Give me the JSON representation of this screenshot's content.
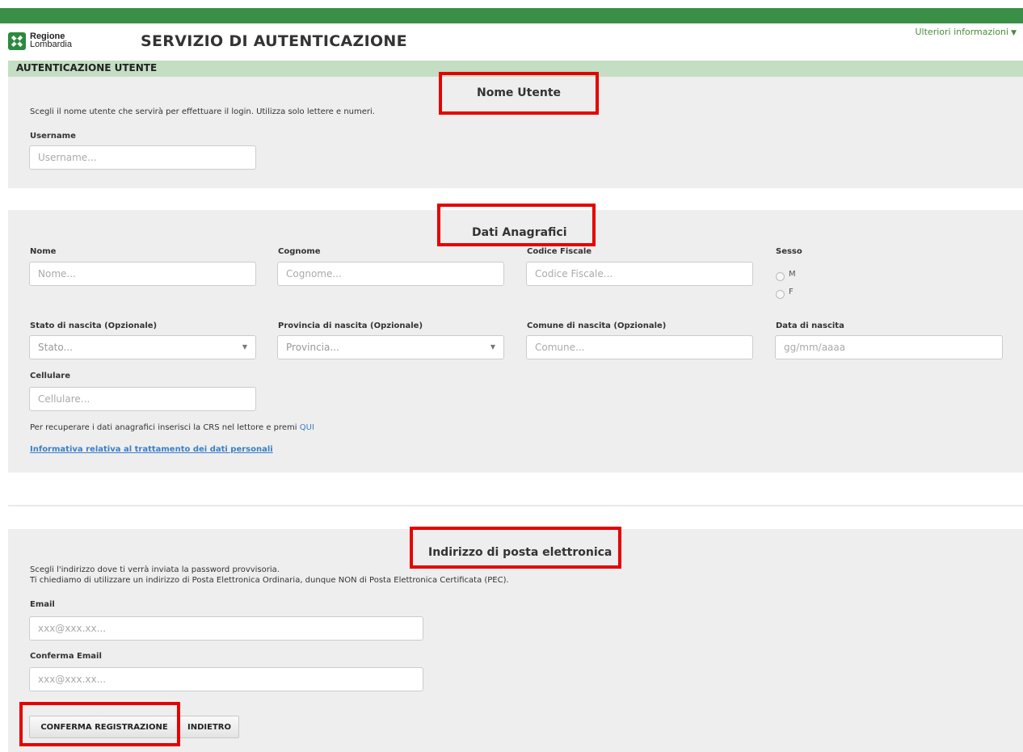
{
  "header": {
    "logo_line1": "Regione",
    "logo_line2": "Lombardia",
    "title": "SERVIZIO DI AUTENTICAZIONE",
    "more_info": "Ulteriori informazioni",
    "section": "AUTENTICAZIONE UTENTE"
  },
  "username_section": {
    "title": "Nome Utente",
    "help": "Scegli il nome utente che servirà per effettuare il login. Utilizza solo lettere e numeri.",
    "label": "Username",
    "placeholder": "Username..."
  },
  "personal_section": {
    "title": "Dati Anagrafici",
    "nome_label": "Nome",
    "nome_placeholder": "Nome...",
    "cognome_label": "Cognome",
    "cognome_placeholder": "Cognome...",
    "cf_label": "Codice Fiscale",
    "cf_placeholder": "Codice Fiscale...",
    "sesso_label": "Sesso",
    "sesso_m": "M",
    "sesso_f": "F",
    "stato_label": "Stato di nascita (Opzionale)",
    "stato_value": "Stato...",
    "provincia_label": "Provincia di nascita (Opzionale)",
    "provincia_value": "Provincia...",
    "comune_label": "Comune di nascita (Opzionale)",
    "comune_placeholder": "Comune...",
    "data_label": "Data di nascita",
    "data_placeholder": "gg/mm/aaaa",
    "cellulare_label": "Cellulare",
    "cellulare_placeholder": "Cellulare...",
    "crs_text": "Per recuperare i dati anagrafici inserisci la CRS nel lettore e premi ",
    "crs_link": "QUI",
    "privacy_link": "Informativa relativa al trattamento dei dati personali"
  },
  "email_section": {
    "title": "Indirizzo di posta elettronica",
    "help_line1": "Scegli l'indirizzo dove ti verrà inviata la password provvisoria.",
    "help_line2": "Ti chiediamo di utilizzare un indirizzo di Posta Elettronica Ordinaria, dunque NON di Posta Elettronica Certificata (PEC).",
    "email_label": "Email",
    "email_placeholder": "xxx@xxx.xx...",
    "confirm_label": "Conferma Email",
    "confirm_placeholder": "xxx@xxx.xx..."
  },
  "actions": {
    "confirm": "CONFERMA REGISTRAZIONE",
    "back": "INDIETRO"
  },
  "colors": {
    "topbar": "#3a8f46",
    "section_header": "#c3dec3",
    "panel": "#eeeeee",
    "highlight": "#e60000",
    "link": "#3b7fc4"
  }
}
